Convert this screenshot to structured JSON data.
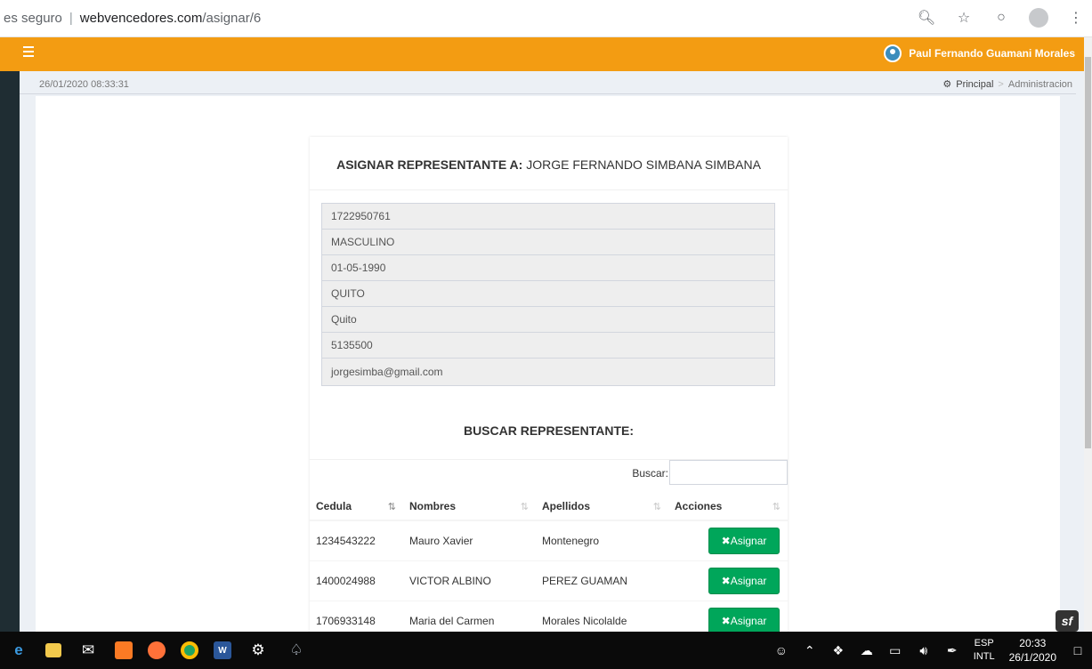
{
  "browser": {
    "security_label": "es seguro",
    "url_host": "webvencedores.com",
    "url_path": "/asignar/6",
    "icons": [
      "zoom-icon",
      "star-icon",
      "shield-extension-icon",
      "profile-icon",
      "menu-dots-icon"
    ]
  },
  "header": {
    "menu_icon": "hamburger-icon",
    "user_name": "Paul Fernando Guamani Morales",
    "accent_color": "#f39c12"
  },
  "content_header": {
    "datetime": "26/01/2020 08:33:31",
    "breadcrumb": [
      "Principal",
      "Administracion"
    ]
  },
  "assign": {
    "title_bold": "ASIGNAR REPRESENTANTE A:",
    "title_name": "JORGE FERNANDO SIMBANA SIMBANA",
    "fields": [
      "1722950761",
      "MASCULINO",
      "01-05-1990",
      "QUITO",
      "Quito",
      "5135500",
      "jorgesimba@gmail.com"
    ]
  },
  "search": {
    "title": "BUSCAR REPRESENTANTE:",
    "label": "Buscar:",
    "value": ""
  },
  "table": {
    "columns": [
      "Cedula",
      "Nombres",
      "Apellidos",
      "Acciones"
    ],
    "rows": [
      {
        "cedula": "1234543222",
        "nombres": "Mauro Xavier",
        "apellidos": "Montenegro",
        "accion": "Asignar"
      },
      {
        "cedula": "1400024988",
        "nombres": "VICTOR ALBINO",
        "apellidos": "PEREZ GUAMAN",
        "accion": "Asignar"
      },
      {
        "cedula": "1706933148",
        "nombres": "Maria del Carmen",
        "apellidos": "Morales Nicolalde",
        "accion": "Asignar"
      }
    ],
    "button_color": "#00a65a"
  },
  "taskbar": {
    "lang_top": "ESP",
    "lang_bottom": "INTL",
    "time": "20:33",
    "date": "26/1/2020"
  }
}
